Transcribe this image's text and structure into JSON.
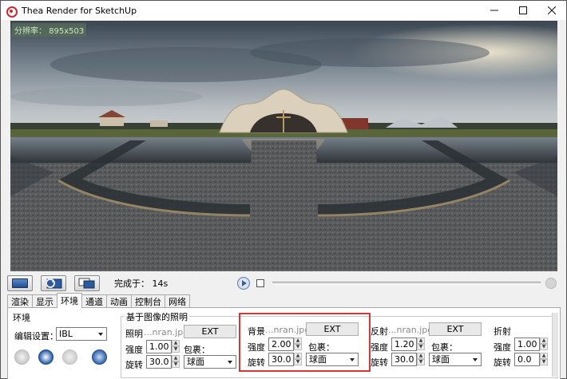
{
  "window": {
    "title": "Thea Render for SketchUp",
    "icon": "thea-logo-icon",
    "controls": [
      "minimize-icon",
      "maximize-icon",
      "close-icon"
    ]
  },
  "viewport": {
    "resolution_label": "分辨率： 895x503"
  },
  "toolbar": {
    "status_text": "完成于： 14s",
    "progress": 0
  },
  "tabs": [
    {
      "label": "渲染",
      "active": false
    },
    {
      "label": "显示",
      "active": false
    },
    {
      "label": "环境",
      "active": true
    },
    {
      "label": "通道",
      "active": false
    },
    {
      "label": "动画",
      "active": false
    },
    {
      "label": "控制台",
      "active": false
    },
    {
      "label": "网络",
      "active": false
    }
  ],
  "environment": {
    "group_title": "环境",
    "preset_label": "编辑设置：",
    "preset_value": "IBL"
  },
  "ibl": {
    "group_title": "基于图像的照明",
    "lighting": {
      "title": "照明",
      "file": "...nran.jpg",
      "ext": "EXT",
      "intensity_label": "强度",
      "intensity": "1.00",
      "wrap_label": "包裹：",
      "rotation_label": "旋转",
      "rotation": "30.0",
      "wrap_value": "球面"
    },
    "background": {
      "title": "背景",
      "file": "...nran.jpg",
      "ext": "EXT",
      "intensity_label": "强度",
      "intensity": "2.00",
      "wrap_label": "包裹：",
      "rotation_label": "旋转",
      "rotation": "30.0",
      "wrap_value": "球面"
    },
    "reflection": {
      "title": "反射",
      "file": "...nran.jpg",
      "ext": "EXT",
      "intensity_label": "强度",
      "intensity": "1.20",
      "wrap_label": "包裹：",
      "rotation_label": "旋转",
      "rotation": "30.0",
      "wrap_value": "球面"
    },
    "refraction": {
      "title": "折射",
      "intensity_label": "强度",
      "intensity": "1.00",
      "rotation_label": "旋转",
      "rotation": "0.0"
    }
  },
  "colors": {
    "highlight": "#d93535",
    "accent_blue": "#2a5ea8"
  }
}
